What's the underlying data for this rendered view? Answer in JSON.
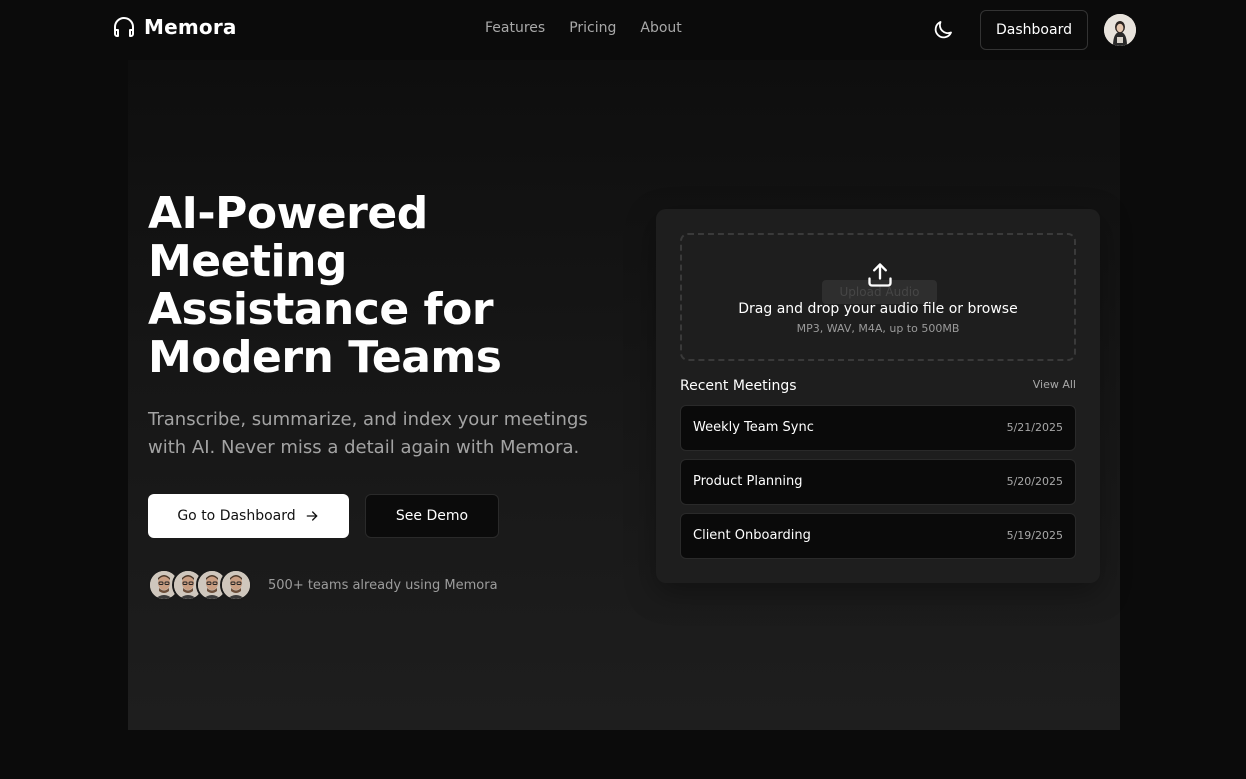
{
  "brand": {
    "name": "Memora",
    "icon": "headphones-icon"
  },
  "nav": {
    "links": [
      "Features",
      "Pricing",
      "About"
    ],
    "theme_icon": "moon-icon",
    "dashboard_label": "Dashboard",
    "avatar_icon": "user-avatar"
  },
  "hero": {
    "headline_lines": [
      "AI-Powered",
      "Meeting",
      "Assistance for",
      "Modern Teams"
    ],
    "subtitle_lines": [
      "Transcribe, summarize, and index your meetings",
      "with AI. Never miss a detail again with Memora."
    ],
    "primary_button": "Go to Dashboard",
    "primary_button_icon": "arrow-right-icon",
    "secondary_button": "See Demo",
    "social_proof": "500+ teams already using Memora"
  },
  "upload": {
    "ghost_label": "Upload Audio",
    "icon": "upload-icon",
    "title": "Drag and drop your audio file or browse",
    "subtitle": "MP3, WAV, M4A, up to 500MB"
  },
  "recent": {
    "title": "Recent Meetings",
    "view_all": "View All",
    "meetings": [
      {
        "name": "Weekly Team Sync",
        "date": "5/21/2025"
      },
      {
        "name": "Product Planning",
        "date": "5/20/2025"
      },
      {
        "name": "Client Onboarding",
        "date": "5/19/2025"
      }
    ]
  },
  "colors": {
    "background": "#0b0b0b",
    "card": "#1e1e1e",
    "text_primary": "#ffffff",
    "text_muted": "#a3a3a3"
  }
}
